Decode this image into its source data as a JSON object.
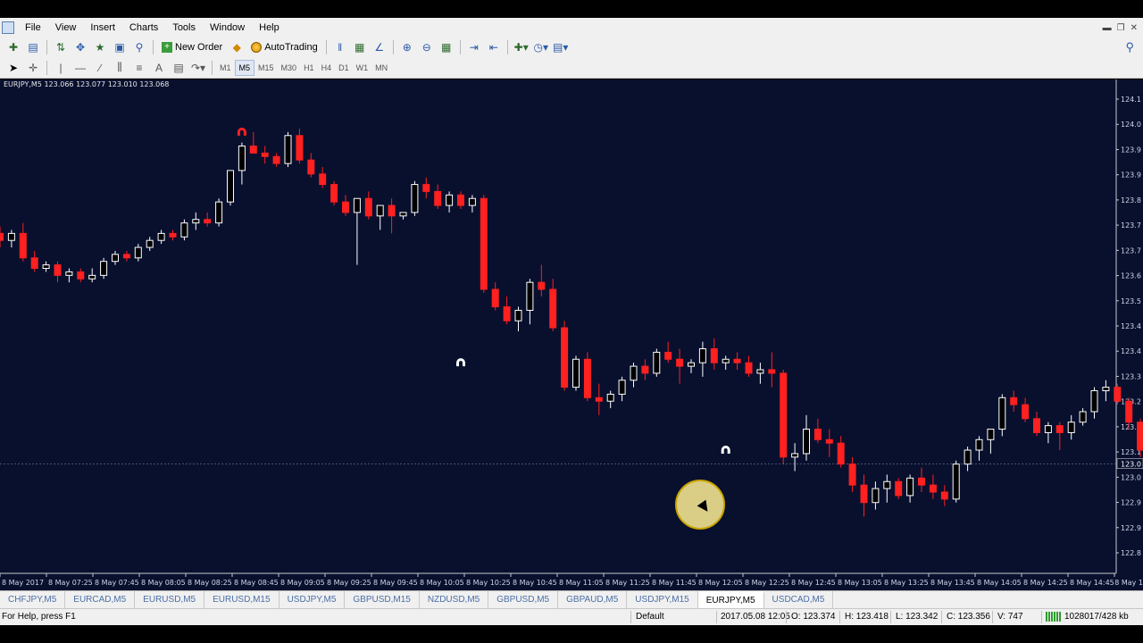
{
  "menu": [
    "File",
    "View",
    "Insert",
    "Charts",
    "Tools",
    "Window",
    "Help"
  ],
  "toolbar": {
    "new_order": "New Order",
    "auto_trading": "AutoTrading",
    "timeframes": [
      "M1",
      "M5",
      "M15",
      "M30",
      "H1",
      "H4",
      "D1",
      "W1",
      "MN"
    ],
    "active_timeframe": "M5"
  },
  "chart": {
    "title": "EURJPY,M5  123.066 123.077 123.010 123.068",
    "colors": {
      "background": "#08102e",
      "bull": "#ffffff",
      "bear": "#ff2020",
      "axis_text": "#cfd6e6"
    },
    "price_labels": [
      "124.1",
      "124.0",
      "123.9",
      "123.9",
      "123.8",
      "123.7",
      "123.7",
      "123.6",
      "123.5",
      "123.4",
      "123.4",
      "123.3",
      "123.2",
      "123.2",
      "123.1",
      "123.0",
      "122.9",
      "122.9",
      "122.8"
    ],
    "current_price_label": "123.0",
    "time_labels": [
      "8 May 2017",
      "8 May 07:25",
      "8 May 07:45",
      "8 May 08:05",
      "8 May 08:25",
      "8 May 08:45",
      "8 May 09:05",
      "8 May 09:25",
      "8 May 09:45",
      "8 May 10:05",
      "8 May 10:25",
      "8 May 10:45",
      "8 May 11:05",
      "8 May 11:25",
      "8 May 11:45",
      "8 May 12:05",
      "8 May 12:25",
      "8 May 12:45",
      "8 May 13:05",
      "8 May 13:25",
      "8 May 13:45",
      "8 May 14:05",
      "8 May 14:25",
      "8 May 14:45",
      "8 May 1"
    ],
    "candles": [
      [
        123.74,
        123.76,
        123.7,
        123.72
      ],
      [
        123.72,
        123.75,
        123.7,
        123.74
      ],
      [
        123.74,
        123.77,
        123.66,
        123.67
      ],
      [
        123.67,
        123.69,
        123.63,
        123.64
      ],
      [
        123.64,
        123.66,
        123.63,
        123.65
      ],
      [
        123.65,
        123.66,
        123.6,
        123.62
      ],
      [
        123.62,
        123.64,
        123.6,
        123.63
      ],
      [
        123.63,
        123.64,
        123.6,
        123.61
      ],
      [
        123.61,
        123.64,
        123.6,
        123.62
      ],
      [
        123.62,
        123.67,
        123.61,
        123.66
      ],
      [
        123.66,
        123.69,
        123.65,
        123.68
      ],
      [
        123.68,
        123.69,
        123.66,
        123.67
      ],
      [
        123.67,
        123.71,
        123.66,
        123.7
      ],
      [
        123.7,
        123.73,
        123.69,
        123.72
      ],
      [
        123.72,
        123.75,
        123.71,
        123.74
      ],
      [
        123.74,
        123.75,
        123.72,
        123.73
      ],
      [
        123.73,
        123.78,
        123.72,
        123.77
      ],
      [
        123.77,
        123.8,
        123.75,
        123.78
      ],
      [
        123.78,
        123.8,
        123.76,
        123.77
      ],
      [
        123.77,
        123.84,
        123.76,
        123.83
      ],
      [
        123.83,
        123.89,
        123.82,
        123.92
      ],
      [
        123.92,
        124.0,
        123.88,
        123.99
      ],
      [
        123.99,
        124.03,
        123.97,
        123.97
      ],
      [
        123.97,
        123.99,
        123.94,
        123.96
      ],
      [
        123.96,
        123.97,
        123.93,
        123.94
      ],
      [
        123.94,
        124.03,
        123.93,
        124.02
      ],
      [
        124.02,
        124.04,
        123.94,
        123.95
      ],
      [
        123.95,
        123.97,
        123.9,
        123.91
      ],
      [
        123.91,
        123.93,
        123.87,
        123.88
      ],
      [
        123.88,
        123.89,
        123.82,
        123.83
      ],
      [
        123.83,
        123.85,
        123.79,
        123.8
      ],
      [
        123.8,
        123.84,
        123.65,
        123.84
      ],
      [
        123.84,
        123.86,
        123.78,
        123.79
      ],
      [
        123.79,
        123.81,
        123.75,
        123.82
      ],
      [
        123.82,
        123.84,
        123.74,
        123.79
      ],
      [
        123.79,
        123.8,
        123.78,
        123.8
      ],
      [
        123.8,
        123.89,
        123.79,
        123.88
      ],
      [
        123.88,
        123.9,
        123.84,
        123.86
      ],
      [
        123.86,
        123.88,
        123.81,
        123.82
      ],
      [
        123.82,
        123.86,
        123.8,
        123.85
      ],
      [
        123.85,
        123.86,
        123.81,
        123.82
      ],
      [
        123.82,
        123.85,
        123.8,
        123.84
      ],
      [
        123.84,
        123.85,
        123.57,
        123.58
      ],
      [
        123.58,
        123.6,
        123.52,
        123.53
      ],
      [
        123.53,
        123.56,
        123.48,
        123.49
      ],
      [
        123.49,
        123.53,
        123.46,
        123.52
      ],
      [
        123.52,
        123.61,
        123.48,
        123.6
      ],
      [
        123.6,
        123.65,
        123.56,
        123.58
      ],
      [
        123.58,
        123.61,
        123.46,
        123.47
      ],
      [
        123.47,
        123.49,
        123.29,
        123.3
      ],
      [
        123.3,
        123.39,
        123.29,
        123.38
      ],
      [
        123.38,
        123.4,
        123.26,
        123.27
      ],
      [
        123.27,
        123.31,
        123.22,
        123.26
      ],
      [
        123.26,
        123.29,
        123.24,
        123.28
      ],
      [
        123.28,
        123.33,
        123.26,
        123.32
      ],
      [
        123.32,
        123.37,
        123.3,
        123.36
      ],
      [
        123.36,
        123.38,
        123.32,
        123.34
      ],
      [
        123.34,
        123.41,
        123.33,
        123.4
      ],
      [
        123.4,
        123.43,
        123.37,
        123.38
      ],
      [
        123.38,
        123.41,
        123.31,
        123.36
      ],
      [
        123.36,
        123.38,
        123.34,
        123.37
      ],
      [
        123.37,
        123.43,
        123.33,
        123.41
      ],
      [
        123.41,
        123.44,
        123.35,
        123.37
      ],
      [
        123.37,
        123.39,
        123.35,
        123.38
      ],
      [
        123.38,
        123.4,
        123.35,
        123.37
      ],
      [
        123.37,
        123.39,
        123.33,
        123.34
      ],
      [
        123.34,
        123.37,
        123.31,
        123.35
      ],
      [
        123.35,
        123.4,
        123.3,
        123.34
      ],
      [
        123.34,
        123.35,
        123.08,
        123.1
      ],
      [
        123.1,
        123.14,
        123.06,
        123.11
      ],
      [
        123.11,
        123.22,
        123.09,
        123.18
      ],
      [
        123.18,
        123.21,
        123.14,
        123.15
      ],
      [
        123.15,
        123.18,
        123.1,
        123.14
      ],
      [
        123.14,
        123.16,
        123.07,
        123.08
      ],
      [
        123.08,
        123.1,
        123.0,
        123.02
      ],
      [
        123.02,
        123.05,
        122.93,
        122.97
      ],
      [
        122.97,
        123.03,
        122.95,
        123.01
      ],
      [
        123.01,
        123.05,
        122.97,
        123.03
      ],
      [
        123.03,
        123.04,
        122.98,
        122.99
      ],
      [
        122.99,
        123.05,
        122.97,
        123.04
      ],
      [
        123.04,
        123.07,
        123.0,
        123.02
      ],
      [
        123.02,
        123.05,
        122.98,
        123.0
      ],
      [
        123.0,
        123.02,
        122.96,
        122.98
      ],
      [
        122.98,
        123.09,
        122.97,
        123.08
      ],
      [
        123.08,
        123.13,
        123.06,
        123.12
      ],
      [
        123.12,
        123.16,
        123.09,
        123.15
      ],
      [
        123.15,
        123.17,
        123.11,
        123.18
      ],
      [
        123.18,
        123.28,
        123.16,
        123.27
      ],
      [
        123.27,
        123.29,
        123.23,
        123.25
      ],
      [
        123.25,
        123.27,
        123.2,
        123.21
      ],
      [
        123.21,
        123.23,
        123.16,
        123.17
      ],
      [
        123.17,
        123.2,
        123.14,
        123.19
      ],
      [
        123.19,
        123.2,
        123.12,
        123.17
      ],
      [
        123.17,
        123.22,
        123.15,
        123.2
      ],
      [
        123.2,
        123.24,
        123.19,
        123.23
      ],
      [
        123.23,
        123.3,
        123.21,
        123.29
      ],
      [
        123.29,
        123.32,
        123.26,
        123.3
      ],
      [
        123.3,
        123.31,
        123.25,
        123.26
      ],
      [
        123.26,
        123.27,
        123.18,
        123.2
      ],
      [
        123.2,
        123.21,
        123.1,
        123.12
      ],
      [
        123.12,
        123.14,
        123.06,
        123.08
      ]
    ],
    "arrows": [
      {
        "index": 21,
        "price": 124.03,
        "color": "#ff2020",
        "label": "sell-signal-arrow"
      },
      {
        "index": 40,
        "price": 123.37,
        "color": "#ffffff",
        "label": "buy-signal-arrow"
      },
      {
        "index": 63,
        "price": 123.12,
        "color": "#ffffff",
        "label": "buy-signal-arrow"
      }
    ]
  },
  "tabs": [
    "CHFJPY,M5",
    "EURCAD,M5",
    "EURUSD,M5",
    "EURUSD,M15",
    "USDJPY,M5",
    "GBPUSD,M15",
    "NZDUSD,M5",
    "GBPUSD,M5",
    "GBPAUD,M5",
    "USDJPY,M15",
    "EURJPY,M5",
    "USDCAD,M5"
  ],
  "active_tab": "EURJPY,M5",
  "status": {
    "help": "For Help, press F1",
    "profile": "Default",
    "datetime": "2017.05.08 12:05",
    "open": "O: 123.374",
    "high": "H: 123.418",
    "low": "L: 123.342",
    "close": "C: 123.356",
    "volume": "V: 747",
    "traffic": "1028017/428 kb"
  }
}
